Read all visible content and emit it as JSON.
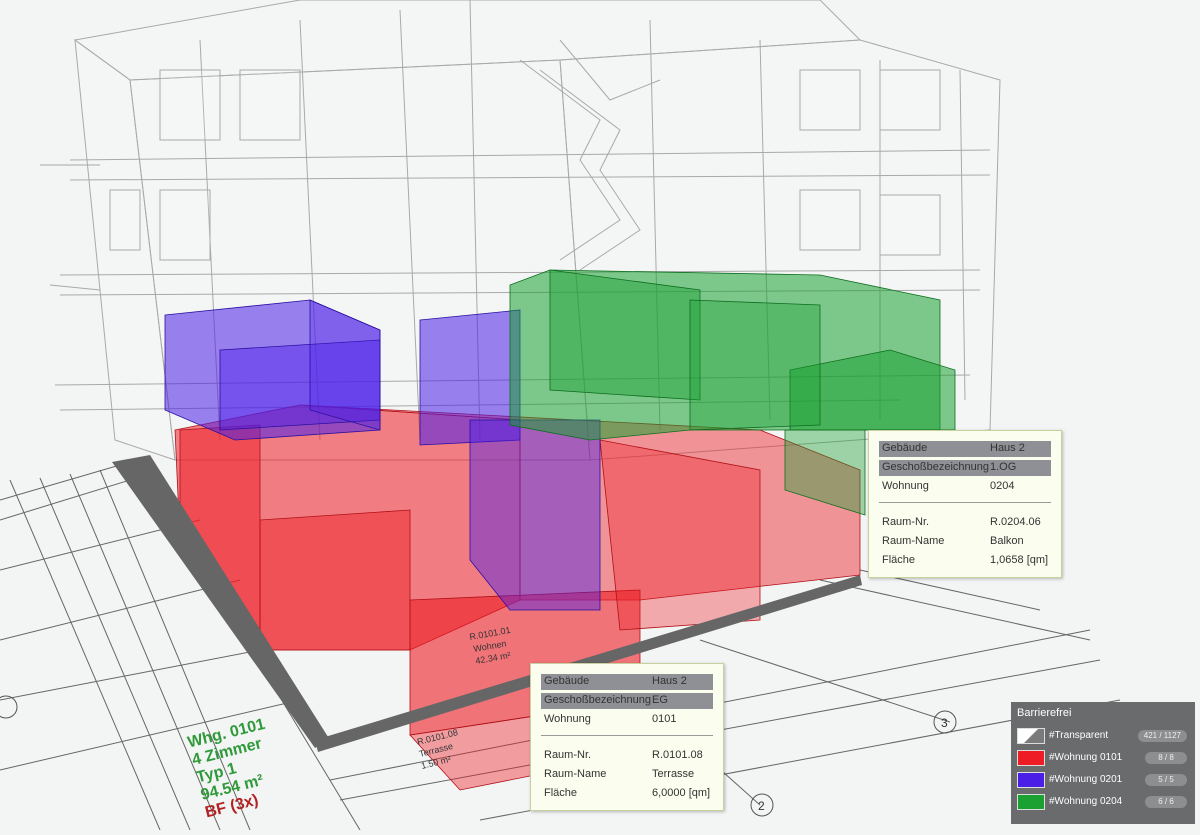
{
  "colors": {
    "wohnung_0101": "#ee1c24",
    "wohnung_0201": "#4b1ee8",
    "wohnung_0204": "#1aa132",
    "transparent_lines": "#9a9a9a",
    "tooltip_bg": "#fbfdef",
    "legend_bg": "#6a6b6d",
    "annotation_green": "#2f9a3a",
    "annotation_red": "#b22222"
  },
  "tooltip_upper": {
    "gebaeude_label": "Gebäude",
    "gebaeude_value": "Haus 2",
    "geschoss_label": "Geschoßbezeichnung",
    "geschoss_value": "1.OG",
    "wohnung_label": "Wohnung",
    "wohnung_value": "0204",
    "raum_nr_label": "Raum-Nr.",
    "raum_nr_value": "R.0204.06",
    "raum_name_label": "Raum-Name",
    "raum_name_value": "Balkon",
    "flaeche_label": "Fläche",
    "flaeche_value": "1,0658 [qm]"
  },
  "tooltip_lower": {
    "gebaeude_label": "Gebäude",
    "gebaeude_value": "Haus 2",
    "geschoss_label": "Geschoßbezeichnung",
    "geschoss_value": "EG",
    "wohnung_label": "Wohnung",
    "wohnung_value": "0101",
    "raum_nr_label": "Raum-Nr.",
    "raum_nr_value": "R.0101.08",
    "raum_name_label": "Raum-Name",
    "raum_name_value": "Terrasse",
    "flaeche_label": "Fläche",
    "flaeche_value": "6,0000 [qm]"
  },
  "legend": {
    "title": "Barrierefrei",
    "items": [
      {
        "label": "#Transparent",
        "count": "421 / 1127"
      },
      {
        "label": "#Wohnung 0101",
        "count": "8 / 8"
      },
      {
        "label": "#Wohnung 0201",
        "count": "5 / 5"
      },
      {
        "label": "#Wohnung 0204",
        "count": "6 / 6"
      }
    ]
  },
  "annotation": {
    "line1": "Whg. 0101",
    "line2": "4 Zimmer",
    "line3": "Typ 1",
    "line4": "94.54 m²",
    "line5": "BF (3x)"
  },
  "plan_labels": {
    "axis_2": "2",
    "axis_3": "3",
    "room_terrasse": "R.0101.08",
    "room_terrasse_name": "Terrasse",
    "room_terrasse_area": "1.50 m²",
    "room_wohnen": "R.0101.01",
    "room_wohnen_name": "Wohnen",
    "room_wohnen_area": "42.34 m²"
  }
}
